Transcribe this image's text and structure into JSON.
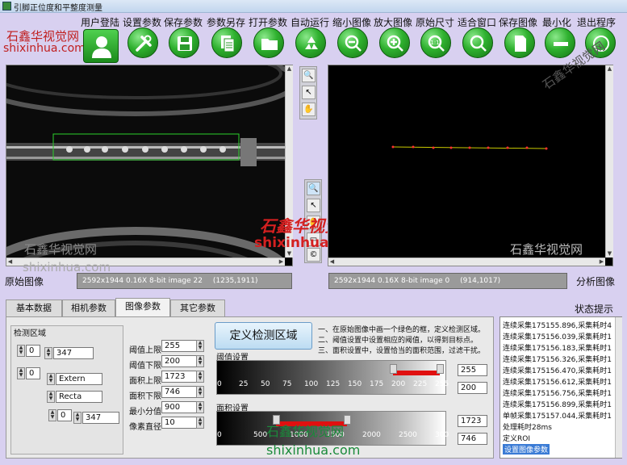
{
  "window": {
    "title": "引脚正位度和平整度测量"
  },
  "toolbar": {
    "labels": [
      "用户登陆",
      "设置参数",
      "保存参数",
      "参数另存",
      "打开参数",
      "自动运行",
      "缩小图像",
      "放大图像",
      "原始尺寸",
      "适合窗口",
      "保存图像",
      "最小化",
      "退出程序"
    ],
    "original_size_icon_text": "1:1"
  },
  "watermarks": {
    "cn": "石鑫华视觉网",
    "en": "shixinhua.com",
    "cn_styled": "石鑫华视觉网",
    "cn_spaced": "石鑫华视觉网"
  },
  "original_view": {
    "label": "原始图像",
    "info": "2592x1944 0.16X 8-bit image 22",
    "coords": "(1235,1911)"
  },
  "analysis_view": {
    "label": "分析图像",
    "info": "2592x1944 0.16X 8-bit image 0",
    "coords": "(914,1017)"
  },
  "status": {
    "label": "状态提示",
    "lines": [
      "连续采集175155.896,采集耗时4",
      "连续采集175156.039,采集耗时1",
      "连续采集175156.183,采集耗时1",
      "连续采集175156.326,采集耗时1",
      "连续采集175156.470,采集耗时1",
      "连续采集175156.612,采集耗时1",
      "连续采集175156.756,采集耗时1",
      "连续采集175156.899,采集耗时1",
      "单帧采集175157.044,采集耗时1",
      "处理耗时28ms",
      "定义ROI",
      "设置图像参数"
    ],
    "selected_index": 11
  },
  "tabs": [
    "基本数据",
    "相机参数",
    "图像参数",
    "其它参数"
  ],
  "active_tab": 2,
  "roi": {
    "group_label": "检测区域",
    "a": "0",
    "b": "347",
    "c": "0",
    "mode1": "Extern",
    "mode2": "Recta",
    "d": "0",
    "e": "347"
  },
  "params": [
    {
      "label": "阈值上限",
      "value": "255"
    },
    {
      "label": "阈值下限",
      "value": "200"
    },
    {
      "label": "面积上限",
      "value": "1723"
    },
    {
      "label": "面积下限",
      "value": "746"
    },
    {
      "label": "最小分值",
      "value": "900"
    },
    {
      "label": "像素直径",
      "value": "10"
    }
  ],
  "define_roi_button": "定义检测区域",
  "instructions": [
    "一、在原始图像中画一个绿色的框，定义检测区域。",
    "二、阈值设置中设置相应的阈值，以得到目标点。",
    "三、面积设置中，设置恰当的面积范围，过滤干扰。"
  ],
  "threshold": {
    "label": "阈值设置",
    "ticks": [
      "0",
      "25",
      "50",
      "75",
      "100",
      "125",
      "150",
      "175",
      "200",
      "225",
      "255"
    ],
    "low": 200,
    "high": 255,
    "max": 255,
    "v1": "255",
    "v2": "200"
  },
  "area": {
    "label": "面积设置",
    "ticks": [
      "0",
      "500",
      "1000",
      "1500",
      "2000",
      "2500",
      "300"
    ],
    "low": 746,
    "high": 1723,
    "max": 3000,
    "v1": "1723",
    "v2": "746"
  }
}
